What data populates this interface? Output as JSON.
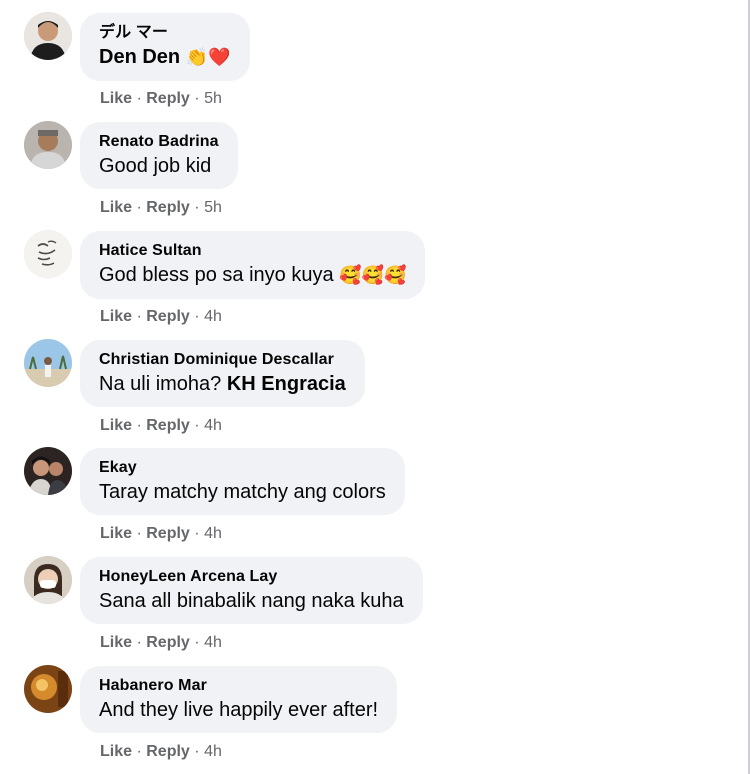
{
  "comments": [
    {
      "author": "デル マー",
      "text": "Den Den",
      "text_emoji": "👏❤️",
      "like": "Like",
      "reply": "Reply",
      "sep": "·",
      "time": "5h"
    },
    {
      "author": "Renato Badrina",
      "text": "Good job kid",
      "like": "Like",
      "reply": "Reply",
      "sep": "·",
      "time": "5h"
    },
    {
      "author": "Hatice Sultan",
      "text": "God bless po sa inyo kuya",
      "text_emoji": "🥰🥰🥰",
      "like": "Like",
      "reply": "Reply",
      "sep": "·",
      "time": "4h"
    },
    {
      "author": "Christian Dominique Descallar",
      "text": "Na uli imoha?",
      "mention": "KH Engracia",
      "like": "Like",
      "reply": "Reply",
      "sep": "·",
      "time": "4h"
    },
    {
      "author": "Ekay",
      "text": "Taray matchy matchy ang colors",
      "like": "Like",
      "reply": "Reply",
      "sep": "·",
      "time": "4h"
    },
    {
      "author": "HoneyLeen Arcena Lay",
      "text": "Sana all binabalik nang naka kuha",
      "like": "Like",
      "reply": "Reply",
      "sep": "·",
      "time": "4h"
    },
    {
      "author": "Habanero Mar",
      "text": "And they live happily ever after!",
      "like": "Like",
      "reply": "Reply",
      "sep": "·",
      "time": "4h"
    }
  ]
}
